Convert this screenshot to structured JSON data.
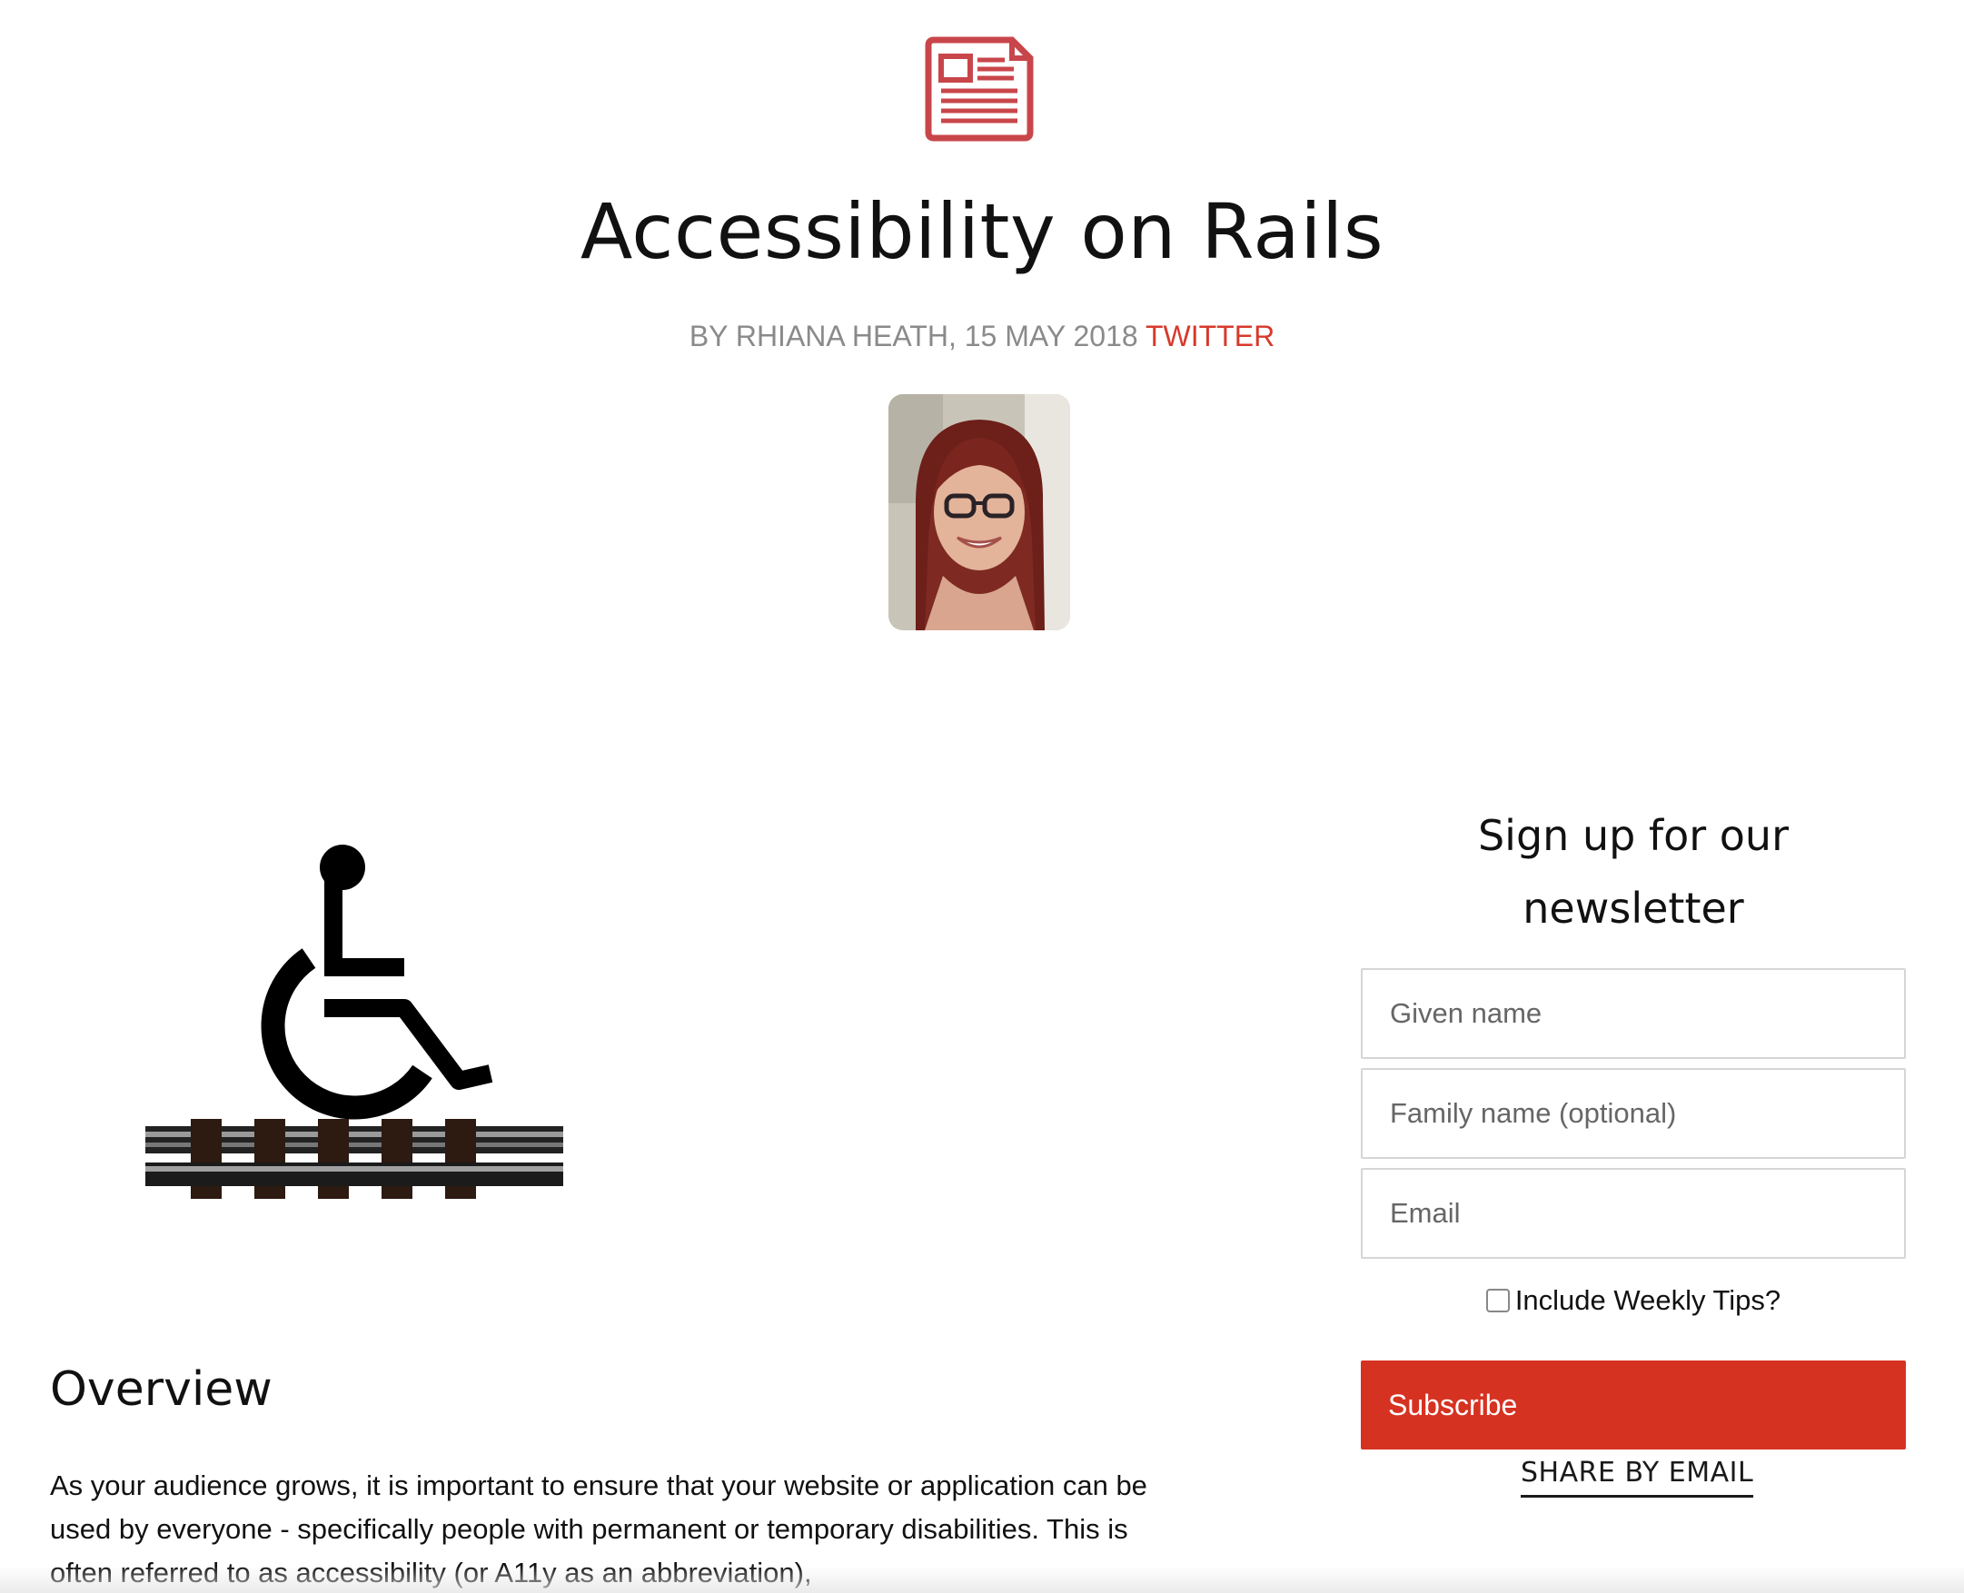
{
  "header": {
    "icon": "newspaper-icon",
    "title": "Accessibility on Rails",
    "byline": {
      "author_date": "BY RHIANA HEATH, 15 MAY 2018 ",
      "twitter_label": "TWITTER"
    },
    "avatar": "author-photo"
  },
  "hero": {
    "icon": "wheelchair-on-rails-icon"
  },
  "article": {
    "heading": "Overview",
    "paragraph": "As your audience grows, it is important to ensure that your website or application can be used by everyone - specifically people with permanent or temporary disabilities. This is often referred to as accessibility (or A11y as an abbreviation),"
  },
  "newsletter": {
    "title": "Sign up for our newsletter",
    "given_name_placeholder": "Given name",
    "family_name_placeholder": "Family name (optional)",
    "email_placeholder": "Email",
    "tips_label": "Include Weekly Tips?",
    "tips_checked": false,
    "subscribe_label": "Subscribe"
  },
  "share": {
    "email_label": "SHARE BY EMAIL"
  },
  "colors": {
    "accent": "#d7392b",
    "button": "#d63222",
    "muted_text": "#8a8a8a"
  }
}
